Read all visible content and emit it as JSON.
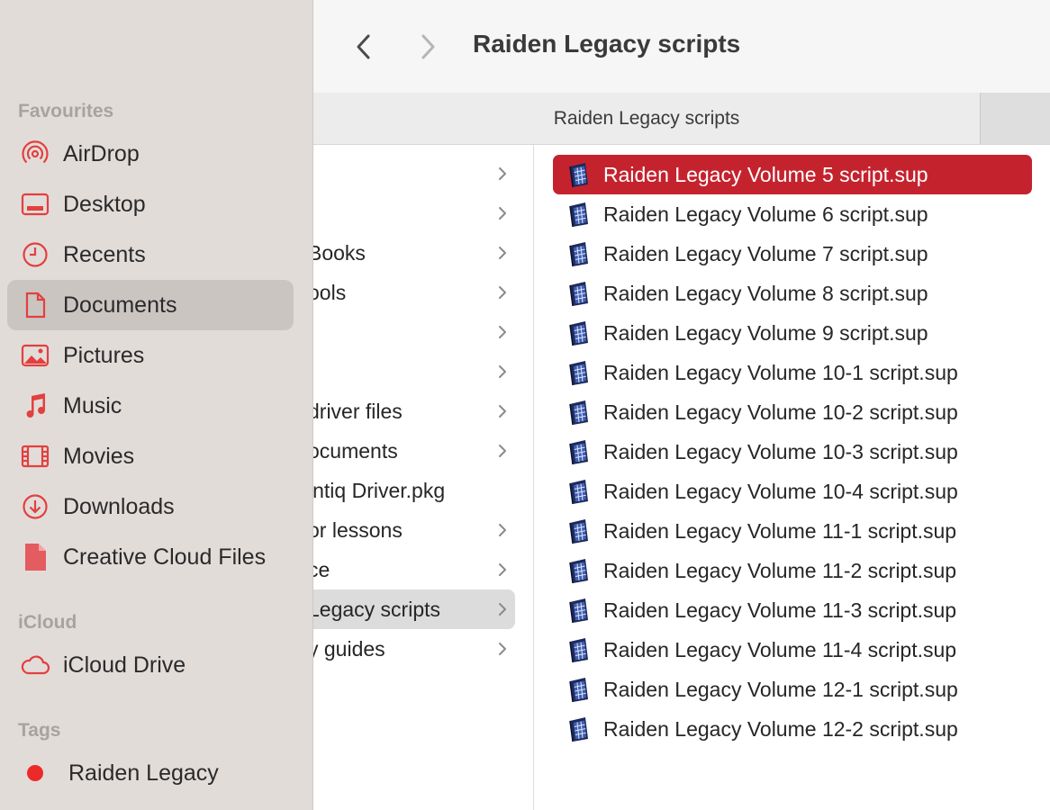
{
  "window": {
    "title": "Raiden Legacy scripts"
  },
  "tab": {
    "title": "Raiden Legacy scripts"
  },
  "sidebar": {
    "favourites_header": "Favourites",
    "favourites": [
      {
        "label": "AirDrop",
        "icon": "airdrop-icon"
      },
      {
        "label": "Desktop",
        "icon": "desktop-icon"
      },
      {
        "label": "Recents",
        "icon": "clock-icon"
      },
      {
        "label": "Documents",
        "icon": "document-icon",
        "selected": true
      },
      {
        "label": "Pictures",
        "icon": "photo-icon"
      },
      {
        "label": "Music",
        "icon": "music-note-icon"
      },
      {
        "label": "Movies",
        "icon": "film-icon"
      },
      {
        "label": "Downloads",
        "icon": "download-icon"
      },
      {
        "label": "Creative Cloud Files",
        "icon": "file-icon"
      }
    ],
    "icloud_header": "iCloud",
    "icloud": [
      {
        "label": "iCloud Drive",
        "icon": "cloud-icon"
      }
    ],
    "tags_header": "Tags",
    "tags": [
      {
        "label": "Raiden Legacy",
        "color": "#ec2a2a"
      }
    ]
  },
  "documents_column": {
    "items": [
      {
        "label": "",
        "folder": true
      },
      {
        "label": "",
        "folder": true
      },
      {
        "label": "Books",
        "folder": true
      },
      {
        "label": "ools",
        "folder": true
      },
      {
        "label": "",
        "folder": true
      },
      {
        "label": "",
        "folder": true
      },
      {
        "label": "driver files",
        "folder": true
      },
      {
        "label": "ocuments",
        "folder": true
      },
      {
        "label": "intiq Driver.pkg",
        "folder": false
      },
      {
        "label": "or lessons",
        "folder": true
      },
      {
        "label": "ce",
        "folder": true
      },
      {
        "label": "Legacy scripts",
        "folder": true,
        "selected": true
      },
      {
        "label": "y guides",
        "folder": true
      }
    ]
  },
  "files_column": {
    "items": [
      {
        "label": "Raiden Legacy Volume 5 script.sup",
        "selected": true
      },
      {
        "label": "Raiden Legacy Volume 6 script.sup"
      },
      {
        "label": "Raiden Legacy Volume 7 script.sup"
      },
      {
        "label": "Raiden Legacy Volume 8 script.sup"
      },
      {
        "label": "Raiden Legacy Volume 9 script.sup"
      },
      {
        "label": "Raiden Legacy Volume 10-1 script.sup"
      },
      {
        "label": "Raiden Legacy Volume 10-2 script.sup"
      },
      {
        "label": "Raiden Legacy Volume 10-3 script.sup"
      },
      {
        "label": "Raiden Legacy Volume 10-4 script.sup"
      },
      {
        "label": "Raiden Legacy Volume 11-1 script.sup"
      },
      {
        "label": "Raiden Legacy Volume 11-2 script.sup"
      },
      {
        "label": "Raiden Legacy Volume 11-3 script.sup"
      },
      {
        "label": "Raiden Legacy Volume 11-4 script.sup"
      },
      {
        "label": "Raiden Legacy Volume 12-1 script.sup"
      },
      {
        "label": "Raiden Legacy Volume 12-2 script.sup"
      }
    ]
  },
  "colors": {
    "accent": "#e2403f",
    "selection": "#c4232e",
    "sidebar_bg": "#e2dcd9"
  }
}
